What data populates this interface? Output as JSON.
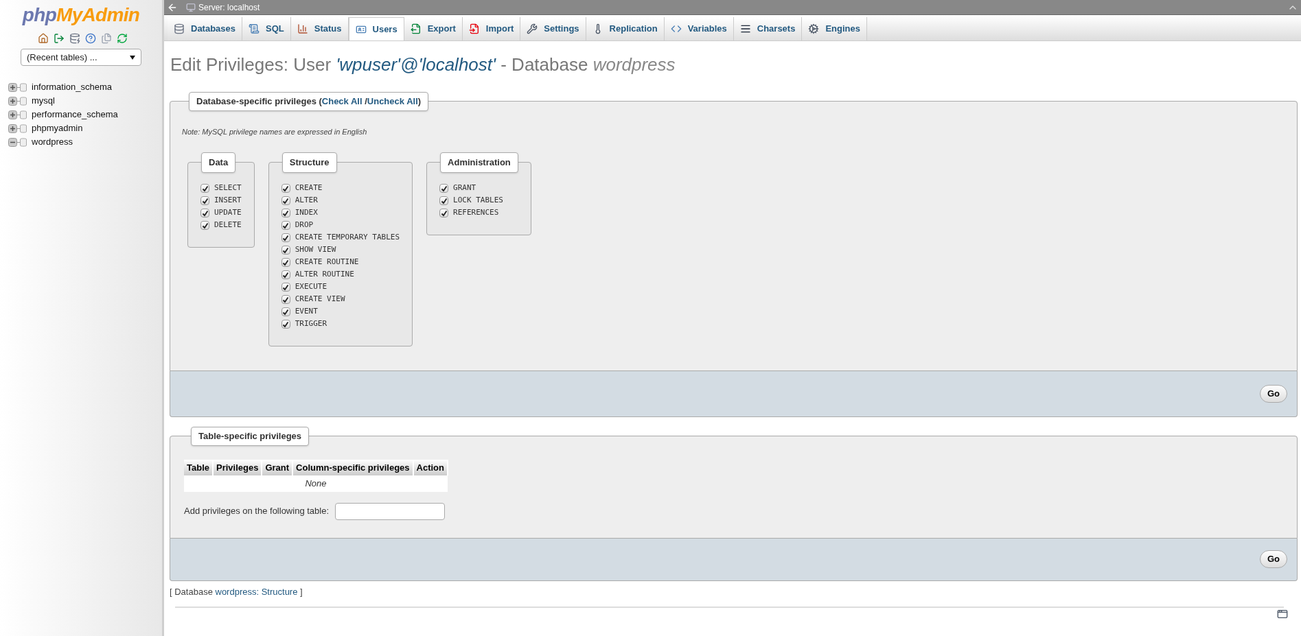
{
  "top_bar": {
    "title": "Server: localhost"
  },
  "sidebar": {
    "logo": {
      "part_1": "php",
      "part_2": "MyAdmin"
    },
    "recent_tables": "(Recent tables) ...",
    "databases": [
      {
        "name": "information_schema",
        "expanded": false
      },
      {
        "name": "mysql",
        "expanded": false
      },
      {
        "name": "performance_schema",
        "expanded": false
      },
      {
        "name": "phpmyadmin",
        "expanded": false
      },
      {
        "name": "wordpress",
        "expanded": true
      }
    ]
  },
  "tabs": [
    {
      "kind": "databases",
      "label": "Databases",
      "selected": false
    },
    {
      "kind": "sql",
      "label": "SQL",
      "selected": false
    },
    {
      "kind": "status",
      "label": "Status",
      "selected": false
    },
    {
      "kind": "users",
      "label": "Users",
      "selected": true
    },
    {
      "kind": "export",
      "label": "Export",
      "selected": false
    },
    {
      "kind": "import",
      "label": "Import",
      "selected": false
    },
    {
      "kind": "settings",
      "label": "Settings",
      "selected": false
    },
    {
      "kind": "replication",
      "label": "Replication",
      "selected": false
    },
    {
      "kind": "variables",
      "label": "Variables",
      "selected": false
    },
    {
      "kind": "charsets",
      "label": "Charsets",
      "selected": false
    },
    {
      "kind": "engines",
      "label": "Engines",
      "selected": false
    }
  ],
  "heading": [
    {
      "kind": "plain",
      "text": "Edit Privileges: User "
    },
    {
      "kind": "user",
      "text": "'wpuser'@'localhost'"
    },
    {
      "kind": "plain",
      "text": " - Database "
    },
    {
      "kind": "database",
      "text": "wordpress"
    }
  ],
  "db_privileges": {
    "legend": [
      {
        "kind": "plain",
        "text": "Database-specific privileges ("
      },
      {
        "kind": "link",
        "text": "Check All"
      },
      {
        "kind": "plain",
        "text": " /"
      },
      {
        "kind": "link",
        "text": "Uncheck All"
      },
      {
        "kind": "plain",
        "text": ")"
      }
    ],
    "note": "Note: MySQL privilege names are expressed in English",
    "groups": [
      {
        "title": "Data",
        "items": [
          {
            "name": "SELECT",
            "checked": true
          },
          {
            "name": "INSERT",
            "checked": true
          },
          {
            "name": "UPDATE",
            "checked": true
          },
          {
            "name": "DELETE",
            "checked": true
          }
        ]
      },
      {
        "title": "Structure",
        "items": [
          {
            "name": "CREATE",
            "checked": true
          },
          {
            "name": "ALTER",
            "checked": true
          },
          {
            "name": "INDEX",
            "checked": true
          },
          {
            "name": "DROP",
            "checked": true
          },
          {
            "name": "CREATE TEMPORARY TABLES",
            "checked": true
          },
          {
            "name": "SHOW VIEW",
            "checked": true
          },
          {
            "name": "CREATE ROUTINE",
            "checked": true
          },
          {
            "name": "ALTER ROUTINE",
            "checked": true
          },
          {
            "name": "EXECUTE",
            "checked": true
          },
          {
            "name": "CREATE VIEW",
            "checked": true
          },
          {
            "name": "EVENT",
            "checked": true
          },
          {
            "name": "TRIGGER",
            "checked": true
          }
        ]
      },
      {
        "title": "Administration",
        "items": [
          {
            "name": "GRANT",
            "checked": true
          },
          {
            "name": "LOCK TABLES",
            "checked": true
          },
          {
            "name": "REFERENCES",
            "checked": true
          }
        ]
      }
    ],
    "go_button": "Go"
  },
  "table_privileges": {
    "legend": "Table-specific privileges",
    "columns": [
      "Table",
      "Privileges",
      "Grant",
      "Column-specific privileges",
      "Action"
    ],
    "empty_text": "None",
    "add_label": "Add privileges on the following table:",
    "go_button": "Go"
  },
  "footer": [
    {
      "kind": "plain",
      "text": "[ Database "
    },
    {
      "kind": "link",
      "text": "wordpress: Structure"
    },
    {
      "kind": "plain",
      "text": " ]"
    }
  ]
}
